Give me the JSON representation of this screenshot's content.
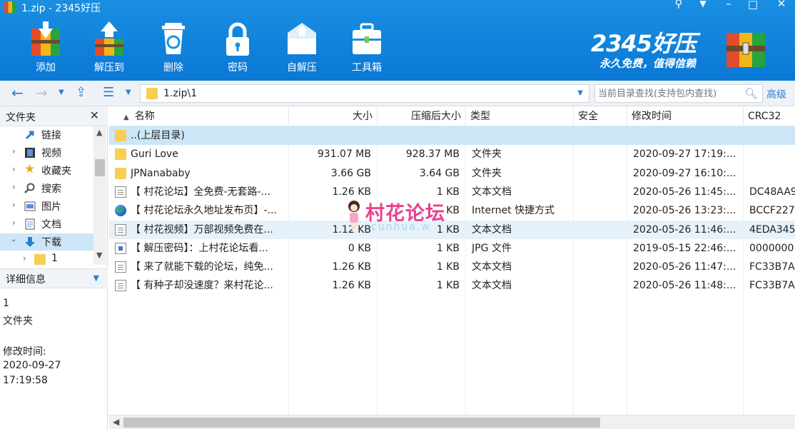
{
  "window": {
    "title": "1.zip - 2345好压",
    "controls": [
      "pin-icon",
      "menu-icon",
      "minimize-icon",
      "maximize-icon",
      "close-icon"
    ]
  },
  "toolbar": {
    "add": "添加",
    "extract_to": "解压到",
    "delete": "删除",
    "password": "密码",
    "self_extract": "自解压",
    "toolbox": "工具箱"
  },
  "brand": {
    "name": "2345好压",
    "slogan": "永久免费，值得信赖"
  },
  "nav": {
    "path": "1.zip\\1",
    "search_placeholder": "当前目录查找(支持包内查找)",
    "advanced": "高级"
  },
  "left_panel": {
    "title": "文件夹",
    "tree": [
      {
        "label": "链接",
        "icon": "link-icon",
        "expanded": null
      },
      {
        "label": "视频",
        "icon": "video-icon",
        "expanded": false
      },
      {
        "label": "收藏夹",
        "icon": "star-icon",
        "expanded": false
      },
      {
        "label": "搜索",
        "icon": "search-icon",
        "expanded": false
      },
      {
        "label": "图片",
        "icon": "image-icon",
        "expanded": false
      },
      {
        "label": "文档",
        "icon": "document-icon",
        "expanded": false
      },
      {
        "label": "下载",
        "icon": "download-icon",
        "expanded": true
      },
      {
        "label": "1",
        "icon": "folder-icon",
        "expanded": false
      }
    ],
    "details_title": "详细信息",
    "details": {
      "name": "1",
      "type": "文件夹",
      "modified_label": "修改时间:",
      "modified_date": "2020-09-27",
      "modified_time": "17:19:58"
    }
  },
  "columns": [
    "名称",
    "大小",
    "压缩后大小",
    "类型",
    "安全",
    "修改时间",
    "CRC32"
  ],
  "files": [
    {
      "name": "..(上层目录)",
      "size": "",
      "packed": "",
      "type": "",
      "security": "",
      "modified": "",
      "crc": "",
      "icon": "folder"
    },
    {
      "name": "Guri Love",
      "size": "931.07 MB",
      "packed": "928.37 MB",
      "type": "文件夹",
      "security": "",
      "modified": "2020-09-27 17:19:...",
      "crc": "",
      "icon": "folder"
    },
    {
      "name": "JPNanababy",
      "size": "3.66 GB",
      "packed": "3.64 GB",
      "type": "文件夹",
      "security": "",
      "modified": "2020-09-27 16:10:...",
      "crc": "",
      "icon": "folder"
    },
    {
      "name": "【 村花论坛】全免费-无套路-...",
      "size": "1.26 KB",
      "packed": "1 KB",
      "type": "文本文档",
      "security": "",
      "modified": "2020-05-26 11:45:...",
      "crc": "DC48AA9",
      "icon": "doc"
    },
    {
      "name": "【 村花论坛永久地址发布页】-...",
      "size": "",
      "packed": "KB",
      "type": "Internet 快捷方式",
      "security": "",
      "modified": "2020-05-26 13:23:...",
      "crc": "BCCF227",
      "icon": "globe"
    },
    {
      "name": "【 村花视频】万部视频免费在...",
      "size": "1.12 KB",
      "packed": "1 KB",
      "type": "文本文档",
      "security": "",
      "modified": "2020-05-26 11:46:...",
      "crc": "4EDA345",
      "icon": "doc"
    },
    {
      "name": "【 解压密码】：上村花论坛看...",
      "size": "0 KB",
      "packed": "1 KB",
      "type": "JPG 文件",
      "security": "",
      "modified": "2019-05-15 22:46:...",
      "crc": "0000000",
      "icon": "jpg"
    },
    {
      "name": "【 来了就能下载的论坛，纯免...",
      "size": "1.26 KB",
      "packed": "1 KB",
      "type": "文本文档",
      "security": "",
      "modified": "2020-05-26 11:47:...",
      "crc": "FC33B7A",
      "icon": "doc"
    },
    {
      "name": "【 有种子却没速度？来村花论...",
      "size": "1.26 KB",
      "packed": "1 KB",
      "type": "文本文档",
      "security": "",
      "modified": "2020-05-26 11:48:...",
      "crc": "FC33B7A",
      "icon": "doc"
    }
  ],
  "watermark": {
    "text": "村花论坛",
    "sub": "cunhua.w"
  },
  "colors": {
    "toolbar_blue": "#0a78d6",
    "selection": "#cde6f7",
    "watermark_pink": "#e8418f"
  }
}
